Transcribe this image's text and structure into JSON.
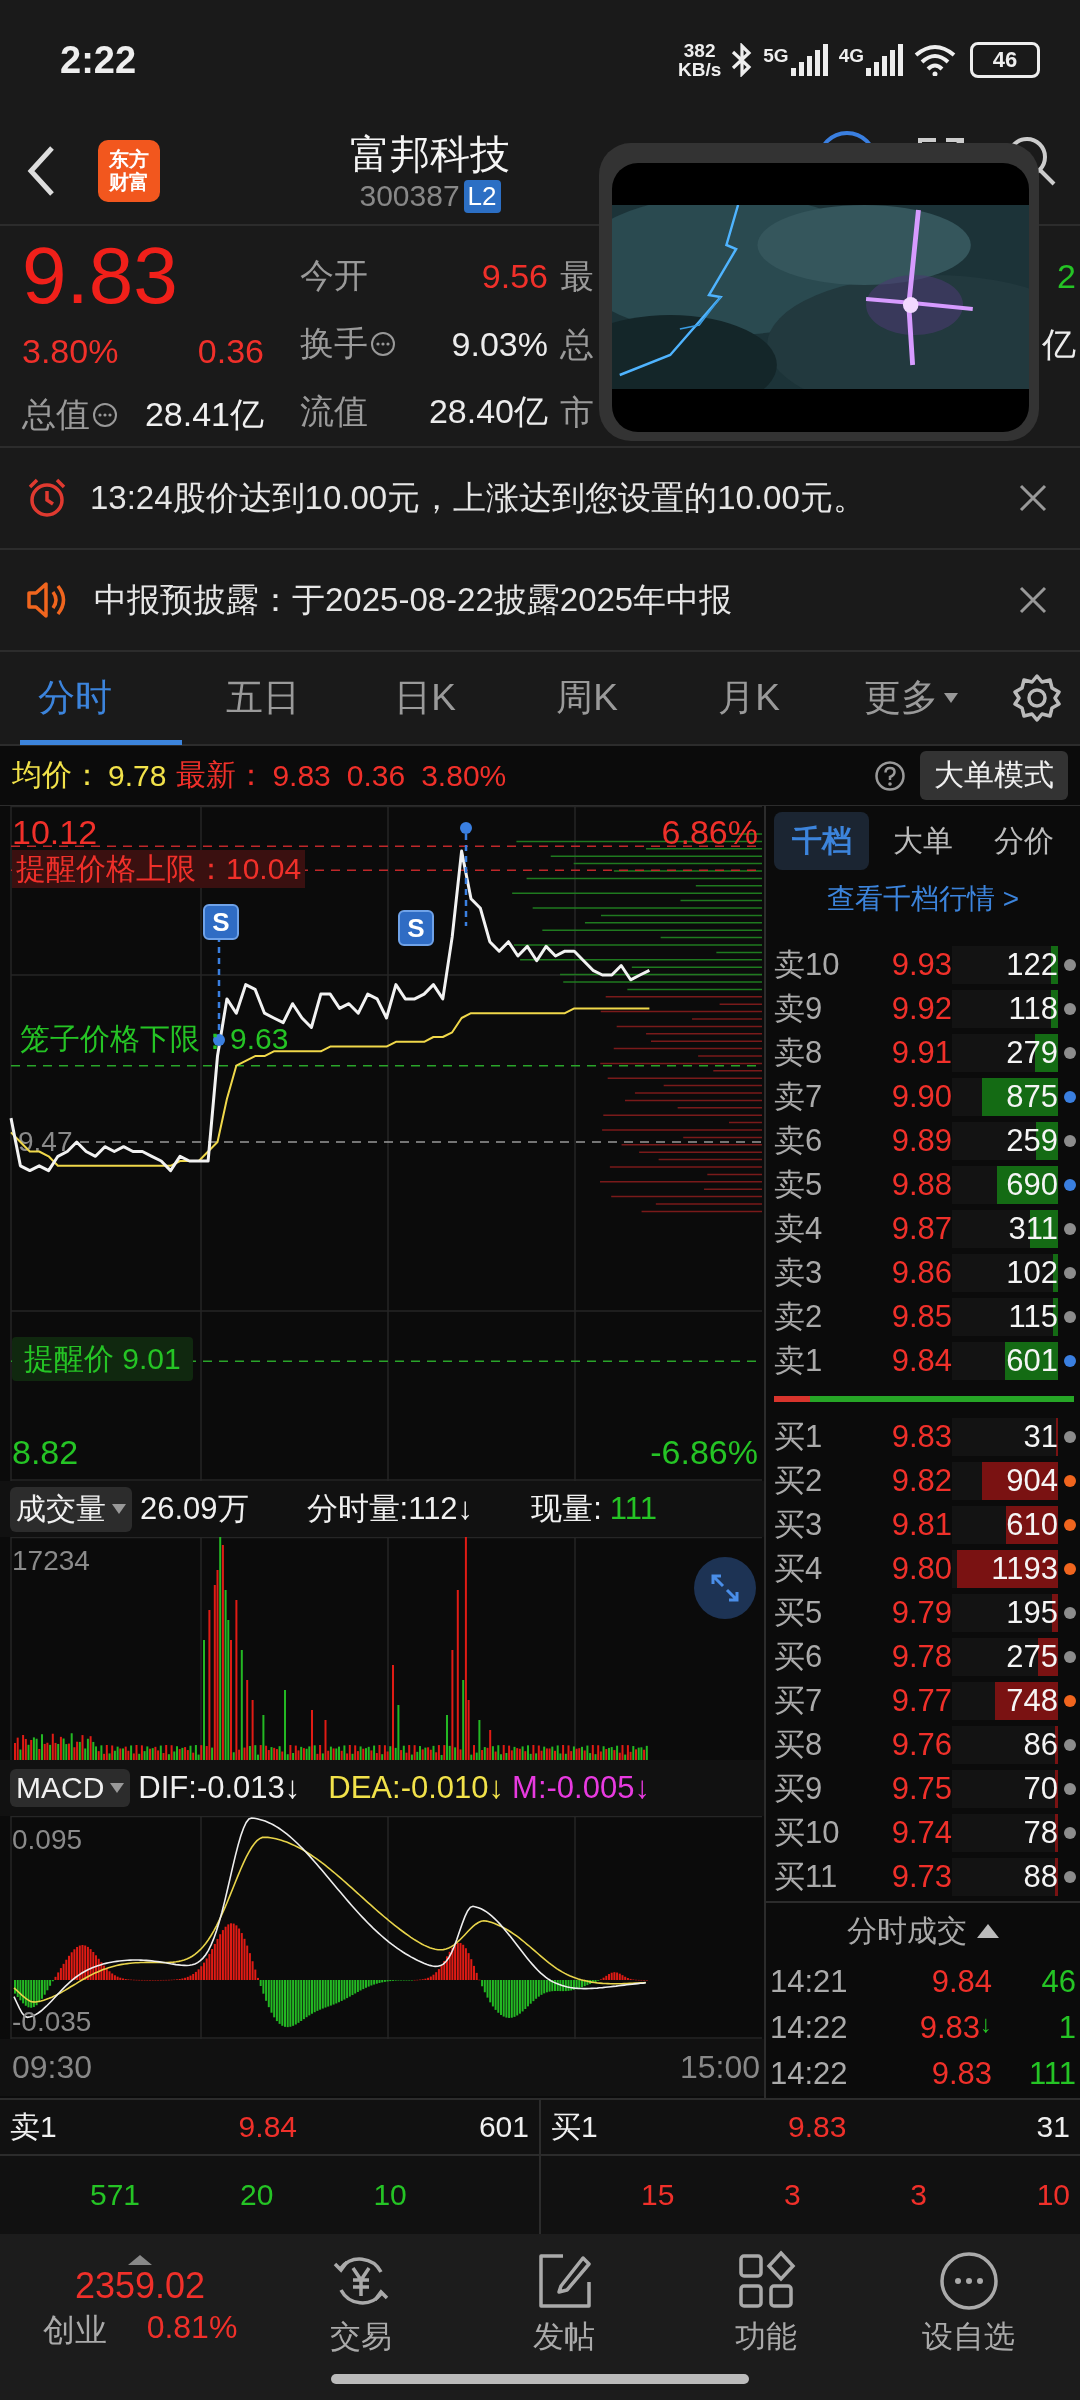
{
  "status_bar": {
    "time": "2:22",
    "net_speed": "382",
    "net_unit": "KB/s",
    "signal_1": "5G",
    "signal_2": "4G",
    "battery": "46"
  },
  "header": {
    "logo_text": [
      "东方",
      "财富"
    ],
    "title": "富邦科技",
    "code": "300387",
    "badge": "L2"
  },
  "quote": {
    "price": "9.83",
    "change_pct": "3.80%",
    "change": "0.36",
    "total_value_label": "总值",
    "total_value": "28.41亿",
    "stats": [
      {
        "label": "今开",
        "value": "9.56",
        "color": "#f0302a",
        "info": false
      },
      {
        "label": "换手",
        "value": "9.03%",
        "color": "#ececec",
        "info": true
      },
      {
        "label": "流值",
        "value": "28.40亿",
        "color": "#ececec",
        "info": false
      }
    ],
    "column_3": [
      "最",
      "总",
      "市"
    ],
    "column_4": [
      {
        "text": "2",
        "color": "#25c425"
      },
      {
        "text": "亿",
        "color": "#ececec"
      }
    ]
  },
  "video_overlay": {
    "kind": "picture"
  },
  "alerts": [
    {
      "kind": "alarm",
      "text": "13:24股价达到10.00元，上涨达到您设置的10.00元。"
    },
    {
      "kind": "notice",
      "text": "中报预披露：于2025-08-22披露2025年中报"
    }
  ],
  "tabs": [
    {
      "label": "分时",
      "selected": true,
      "dropdown": false
    },
    {
      "label": "五日",
      "selected": false,
      "dropdown": false
    },
    {
      "label": "日K",
      "selected": false,
      "dropdown": false
    },
    {
      "label": "周K",
      "selected": false,
      "dropdown": false
    },
    {
      "label": "月K",
      "selected": false,
      "dropdown": false
    },
    {
      "label": "更多",
      "selected": false,
      "dropdown": true
    }
  ],
  "info_bar": {
    "avg_label": "均价：",
    "avg": "9.78",
    "latest_label": "最新：",
    "latest": "9.83",
    "change": "0.36",
    "change_pct": "3.80%",
    "mode_button": "大单模式"
  },
  "price_chart": {
    "high_pct": "6.86%",
    "low_pct": "-6.86%",
    "upper_limit_label": "提醒价格上限：",
    "upper_limit": "10.04",
    "cage_lower_label": "笼子价格下限：",
    "cage_lower": "9.63",
    "alert_price": "提醒价 9.01",
    "markers": [
      "S",
      "S"
    ],
    "chart_data": {
      "type": "line",
      "ylim": [
        8.759,
        10.1745
      ],
      "yticks": [
        {
          "value": 10.12,
          "label": "10.12"
        },
        {
          "value": 9.47,
          "label": "9.47"
        },
        {
          "value": 8.82,
          "label": "8.82"
        }
      ],
      "ref_lines": [
        {
          "axis": "y",
          "value": 10.09,
          "color": "#c0282a"
        },
        {
          "axis": "y",
          "value": 10.04,
          "color": "#c0282a"
        },
        {
          "axis": "y",
          "value": 9.63,
          "color": "#2aa52a"
        },
        {
          "axis": "y",
          "value": 9.01,
          "color": "#2aa52a"
        },
        {
          "axis": "y",
          "value": 9.47,
          "color": "#999999"
        }
      ],
      "categories": [
        null,
        null,
        null,
        null,
        null,
        null,
        null,
        null,
        null,
        null,
        null,
        null,
        null,
        null,
        null,
        null,
        null,
        null,
        null,
        null,
        null,
        null,
        null,
        null,
        null,
        null,
        null,
        null,
        null,
        null,
        null,
        null,
        null,
        null,
        null,
        null,
        null,
        null,
        null,
        null,
        null,
        null,
        null,
        null,
        null,
        null,
        null,
        null,
        null,
        null,
        null,
        null,
        null,
        null,
        null,
        null,
        null,
        null,
        null,
        null,
        null,
        null,
        null,
        null,
        null,
        null,
        null,
        null,
        null,
        null,
        null,
        null,
        null,
        null,
        null,
        null,
        null,
        null,
        null,
        null,
        null
      ],
      "series": [
        {
          "color": "#f2f2f2",
          "values": [
            9.52,
            9.42,
            9.41,
            9.42,
            9.41,
            9.44,
            9.45,
            9.47,
            9.45,
            9.44,
            9.46,
            9.45,
            9.46,
            9.45,
            9.45,
            9.44,
            9.43,
            9.41,
            9.44,
            9.43,
            9.43,
            9.43,
            9.65,
            9.77,
            9.74,
            9.8,
            9.79,
            9.74,
            9.73,
            9.72,
            9.76,
            9.73,
            9.71,
            9.78,
            9.78,
            9.75,
            9.76,
            9.74,
            9.78,
            9.77,
            9.73,
            9.8,
            9.77,
            9.77,
            9.78,
            9.8,
            9.77,
            9.9,
            10.08,
            9.98,
            9.96,
            9.89,
            9.87,
            9.89,
            9.86,
            9.88,
            9.85,
            9.88,
            9.86,
            9.87,
            9.87,
            9.85,
            9.83,
            9.82,
            9.82,
            9.84,
            9.81,
            9.82,
            9.83,
            null,
            null,
            null,
            null,
            null,
            null,
            null,
            null,
            null,
            null,
            null,
            null
          ]
        },
        {
          "color": "#f0d84a",
          "values": [
            9.49,
            9.47,
            9.45,
            9.45,
            9.44,
            9.42,
            9.42,
            9.42,
            9.42,
            9.42,
            9.42,
            9.42,
            9.42,
            9.42,
            9.42,
            9.42,
            9.42,
            9.42,
            9.43,
            9.43,
            9.43,
            9.45,
            9.47,
            9.56,
            9.63,
            9.64,
            9.65,
            9.65,
            9.66,
            9.66,
            9.66,
            9.66,
            9.66,
            9.66,
            9.67,
            9.67,
            9.67,
            9.67,
            9.67,
            9.67,
            9.67,
            9.68,
            9.68,
            9.68,
            9.68,
            9.69,
            9.69,
            9.7,
            9.73,
            9.74,
            9.74,
            9.74,
            9.74,
            9.74,
            9.74,
            9.74,
            9.74,
            9.74,
            9.74,
            9.74,
            9.75,
            9.75,
            9.75,
            9.75,
            9.75,
            9.75,
            9.75,
            9.75,
            9.75,
            null,
            null,
            null,
            null,
            null,
            null,
            null,
            null,
            null,
            null,
            null,
            null
          ]
        }
      ]
    }
  },
  "time_axis": [
    "09:30",
    "15:00"
  ],
  "volume_panel": {
    "selector": "成交量",
    "total": "26.09万",
    "minute_volume": "分时量:112↓",
    "current_label": "现量:",
    "current": "111",
    "max_tick": "17234"
  },
  "macd_panel": {
    "selector": "MACD",
    "dif": "DIF:-0.013↓",
    "dea": "DEA:-0.010↓",
    "m": "M:-0.005↓",
    "top_tick": "0.095",
    "bottom_tick": "-0.035"
  },
  "order_book": {
    "tabs": [
      {
        "label": "千档",
        "selected": true
      },
      {
        "label": "大单",
        "selected": false
      },
      {
        "label": "分价",
        "selected": false
      }
    ],
    "link": "查看千档行情 >",
    "asks": [
      {
        "label": "卖10",
        "price": "9.93",
        "volume": "122",
        "level": 0.07,
        "color": "#8c8c8c"
      },
      {
        "label": "卖9",
        "price": "9.92",
        "volume": "118",
        "level": 0.07,
        "color": "#8c8c8c"
      },
      {
        "label": "卖8",
        "price": "9.91",
        "volume": "279",
        "level": 0.22,
        "color": "#8c8c8c"
      },
      {
        "label": "卖7",
        "price": "9.90",
        "volume": "875",
        "level": 0.72,
        "color": "#3a7fe0"
      },
      {
        "label": "卖6",
        "price": "9.89",
        "volume": "259",
        "level": 0.21,
        "color": "#8c8c8c"
      },
      {
        "label": "卖5",
        "price": "9.88",
        "volume": "690",
        "level": 0.58,
        "color": "#3a7fe0"
      },
      {
        "label": "卖4",
        "price": "9.87",
        "volume": "311",
        "level": 0.26,
        "color": "#8c8c8c"
      },
      {
        "label": "卖3",
        "price": "9.86",
        "volume": "102",
        "level": 0.05,
        "color": "#8c8c8c"
      },
      {
        "label": "卖2",
        "price": "9.85",
        "volume": "115",
        "level": 0.05,
        "color": "#8c8c8c"
      },
      {
        "label": "卖1",
        "price": "9.84",
        "volume": "601",
        "level": 0.5,
        "color": "#3a7fe0"
      }
    ],
    "ratio_bar": {
      "level": 0.12
    },
    "bids": [
      {
        "label": "买1",
        "price": "9.83",
        "volume": "31",
        "level": 0.02,
        "color": "#8c8c8c"
      },
      {
        "label": "买2",
        "price": "9.82",
        "volume": "904",
        "level": 0.72,
        "color": "#f0651e"
      },
      {
        "label": "买3",
        "price": "9.81",
        "volume": "610",
        "level": 0.49,
        "color": "#f0651e"
      },
      {
        "label": "买4",
        "price": "9.80",
        "volume": "1193",
        "level": 0.95,
        "color": "#f0651e"
      },
      {
        "label": "买5",
        "price": "9.79",
        "volume": "195",
        "level": 0.06,
        "color": "#8c8c8c"
      },
      {
        "label": "买6",
        "price": "9.78",
        "volume": "275",
        "level": 0.19,
        "color": "#8c8c8c"
      },
      {
        "label": "买7",
        "price": "9.77",
        "volume": "748",
        "level": 0.59,
        "color": "#f0651e"
      },
      {
        "label": "买8",
        "price": "9.76",
        "volume": "86",
        "level": 0.03,
        "color": "#8c8c8c"
      },
      {
        "label": "买9",
        "price": "9.75",
        "volume": "70",
        "level": 0.03,
        "color": "#8c8c8c"
      },
      {
        "label": "买10",
        "price": "9.74",
        "volume": "78",
        "level": 0.03,
        "color": "#8c8c8c"
      },
      {
        "label": "买11",
        "price": "9.73",
        "volume": "88",
        "level": 0.03,
        "color": "#8c8c8c"
      }
    ],
    "trades_title": "分时成交",
    "trades": [
      {
        "time": "14:21",
        "price": "9.84",
        "volume": "46"
      },
      {
        "time": "14:22",
        "price": "9.83",
        "arrow": "↓",
        "volume": "1"
      },
      {
        "time": "14:22",
        "price": "9.83",
        "volume": "111"
      }
    ]
  },
  "bottom_quote": {
    "ask": {
      "label": "卖1",
      "price": "9.84",
      "volume": "601",
      "fills": [
        "571",
        "20",
        "10"
      ]
    },
    "bid": {
      "label": "买1",
      "price": "9.83",
      "volume": "31",
      "fills": [
        "15",
        "3",
        "3",
        "10"
      ]
    }
  },
  "nav": {
    "index_value": "2359.02",
    "index_name": "创业",
    "index_change": "0.81%",
    "items": [
      {
        "label": "交易",
        "kind": "trade"
      },
      {
        "label": "发帖",
        "kind": "post"
      },
      {
        "label": "功能",
        "kind": "apps"
      },
      {
        "label": "设自选",
        "kind": "more"
      }
    ]
  }
}
